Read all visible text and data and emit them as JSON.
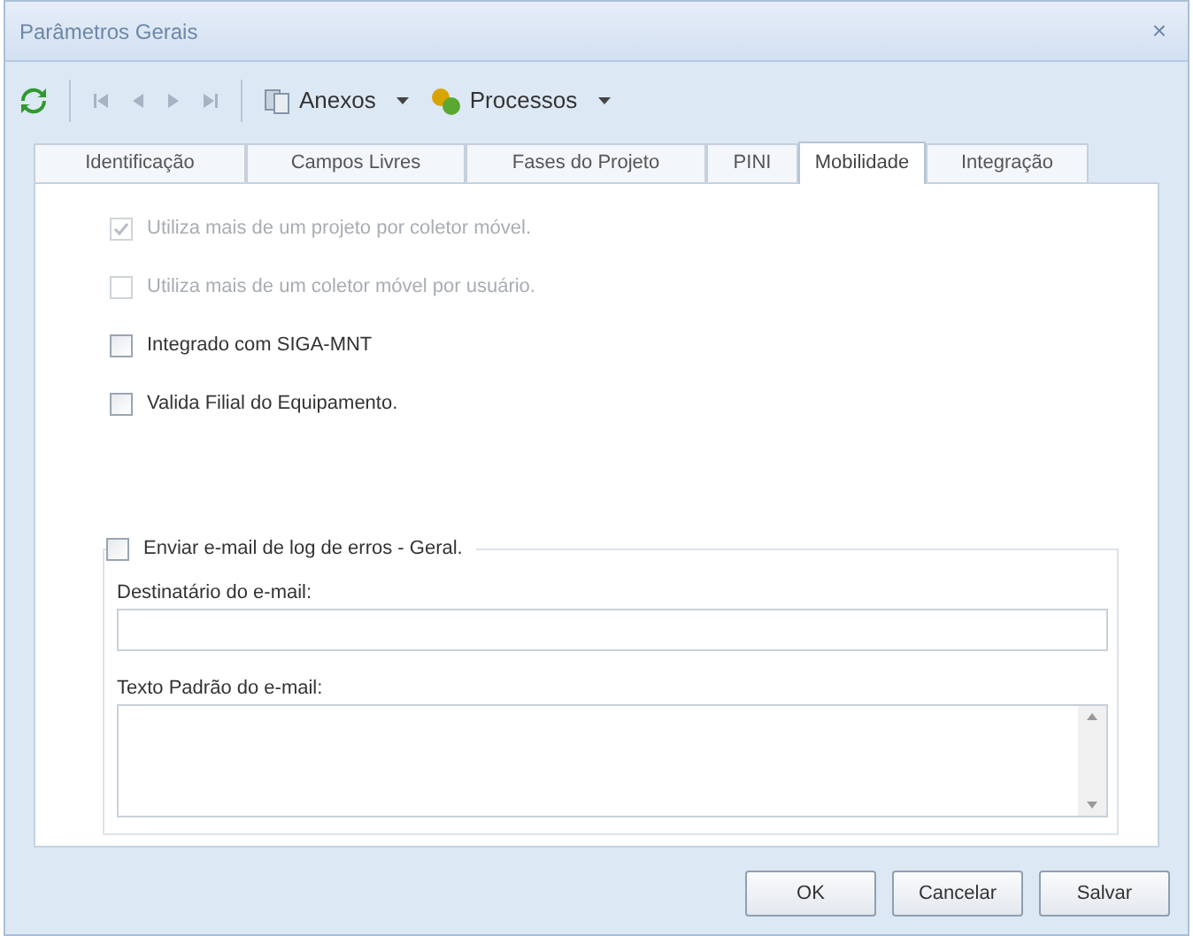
{
  "window": {
    "title": "Parâmetros Gerais",
    "close": "×"
  },
  "toolbar": {
    "menus": [
      {
        "label": "Anexos",
        "kind": "attach"
      },
      {
        "label": "Processos",
        "kind": "process"
      }
    ]
  },
  "tabs": [
    {
      "label": "Identificação",
      "selected": false
    },
    {
      "label": "Campos Livres",
      "selected": false
    },
    {
      "label": "Fases do Projeto",
      "selected": false
    },
    {
      "label": "PINI",
      "selected": false
    },
    {
      "label": "Mobilidade",
      "selected": true
    },
    {
      "label": "Integração",
      "selected": false
    }
  ],
  "options": [
    {
      "label": "Utiliza mais de um projeto por coletor móvel.",
      "checked": true,
      "disabled": true
    },
    {
      "label": "Utiliza mais de um coletor móvel por usuário.",
      "checked": false,
      "disabled": true
    },
    {
      "label": "Integrado com SIGA-MNT",
      "checked": false,
      "disabled": false
    },
    {
      "label": "Valida Filial do Equipamento.",
      "checked": false,
      "disabled": false
    }
  ],
  "email_group": {
    "label": "Enviar e-mail de log de erros - Geral.",
    "checked": false,
    "recipient_label": "Destinatário do e-mail:",
    "text_label": "Texto Padrão do e-mail:"
  },
  "buttons": [
    "OK",
    "Cancelar",
    "Salvar"
  ]
}
